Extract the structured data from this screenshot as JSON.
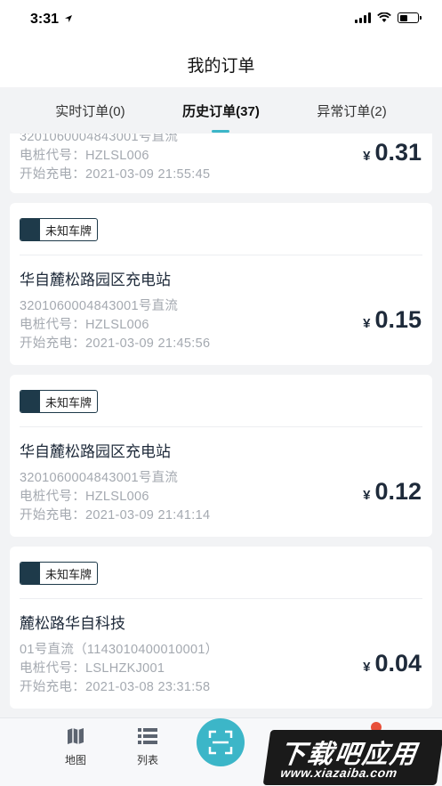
{
  "status": {
    "time": "3:31"
  },
  "header": {
    "title": "我的订单"
  },
  "tabs": [
    {
      "label": "实时订单(0)"
    },
    {
      "label": "历史订单(37)"
    },
    {
      "label": "异常订单(2)"
    }
  ],
  "orders": [
    {
      "plate": "",
      "station": "",
      "pile_line": "3201060004843001号直流",
      "pile_code": "电桩代号：HZLSL006",
      "start": "开始充电：2021-03-09 21:55:45",
      "currency": "¥",
      "amount": "0.31"
    },
    {
      "plate": "未知车牌",
      "station": "华自麓松路园区充电站",
      "pile_line": "3201060004843001号直流",
      "pile_code": "电桩代号：HZLSL006",
      "start": "开始充电：2021-03-09 21:45:56",
      "currency": "¥",
      "amount": "0.15"
    },
    {
      "plate": "未知车牌",
      "station": "华自麓松路园区充电站",
      "pile_line": "3201060004843001号直流",
      "pile_code": "电桩代号：HZLSL006",
      "start": "开始充电：2021-03-09 21:41:14",
      "currency": "¥",
      "amount": "0.12"
    },
    {
      "plate": "未知车牌",
      "station": "麓松路华自科技",
      "pile_line": "01号直流（1143010400010001）",
      "pile_code": "电桩代号：LSLHZKJ001",
      "start": "开始充电：2021-03-08 23:31:58",
      "currency": "¥",
      "amount": "0.04"
    }
  ],
  "tabbar": {
    "map_label": "地图",
    "list_label": "列表"
  },
  "watermark": {
    "title": "下载吧应用",
    "sub": "www.xiazaiba.com"
  },
  "colors": {
    "accent": "#3cb6c8",
    "plate": "#1e3a4a",
    "badge": "#e8503a"
  },
  "icons": [
    "location-arrow-icon",
    "signal-icon",
    "wifi-icon",
    "battery-icon",
    "map-icon",
    "list-icon",
    "scan-icon"
  ]
}
